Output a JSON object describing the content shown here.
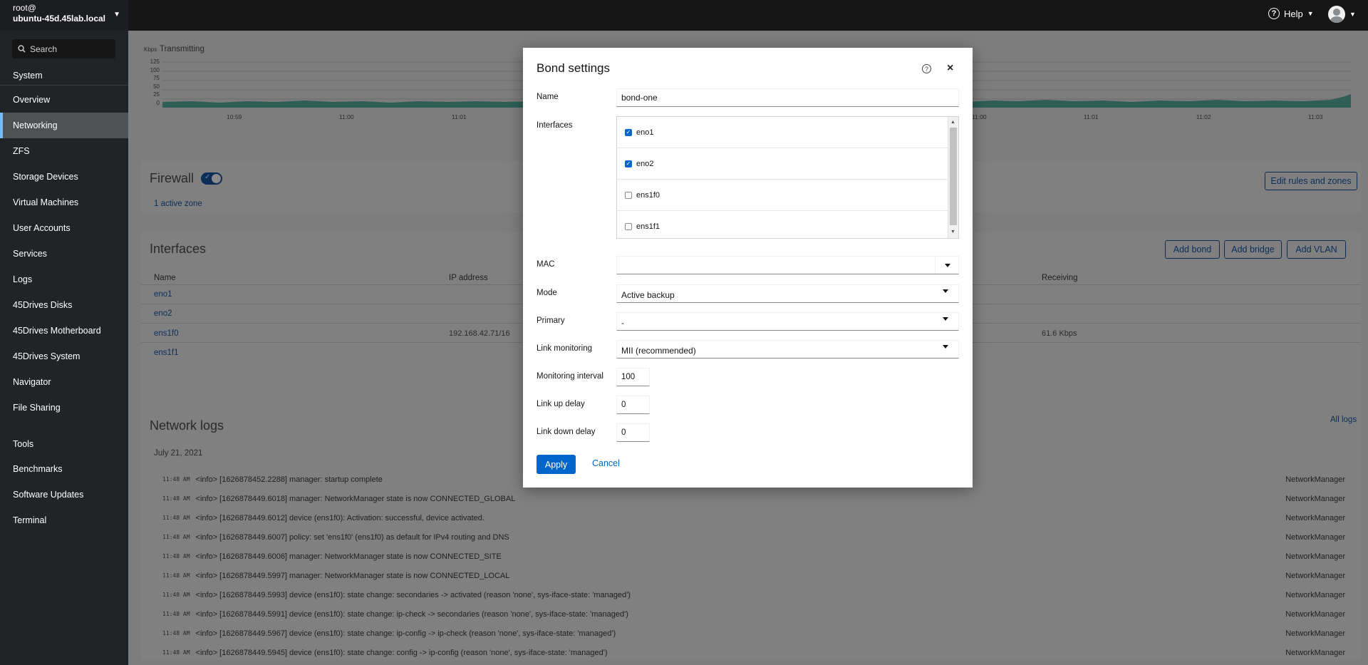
{
  "host": {
    "user": "root@",
    "hostname": "ubuntu-45d.45lab.local"
  },
  "topbar": {
    "help_label": "Help"
  },
  "sidebar": {
    "search_placeholder": "Search",
    "section_system": "System",
    "items": [
      "Overview",
      "Networking",
      "ZFS",
      "Storage Devices",
      "Virtual Machines",
      "User Accounts",
      "Services",
      "Logs",
      "45Drives Disks",
      "45Drives Motherboard",
      "45Drives System",
      "Navigator",
      "File Sharing"
    ],
    "section_tools": "Tools",
    "tools": [
      "Benchmarks",
      "Software Updates",
      "Terminal"
    ],
    "active": "Networking"
  },
  "graph": {
    "unit": "Kbps",
    "title": "Transmitting",
    "y_ticks": [
      "125",
      "100",
      "75",
      "50",
      "25",
      "0"
    ],
    "x_ticks_left": [
      "10:59",
      "11:00",
      "11:01"
    ],
    "x_ticks_right": [
      "11:00",
      "11:01",
      "11:02",
      "11:03"
    ]
  },
  "firewall": {
    "title": "Firewall",
    "enabled": true,
    "zones_link": "1 active zone",
    "edit_button": "Edit rules and zones"
  },
  "interfaces": {
    "title": "Interfaces",
    "buttons": [
      "Add bond",
      "Add bridge",
      "Add VLAN"
    ],
    "columns": {
      "name": "Name",
      "ip": "IP address",
      "receiving": "Receiving"
    },
    "rows": [
      {
        "name": "eno1",
        "ip": "",
        "receiving": ""
      },
      {
        "name": "eno2",
        "ip": "",
        "receiving": ""
      },
      {
        "name": "ens1f0",
        "ip": "192.168.42.71/16",
        "receiving": "61.6 Kbps"
      },
      {
        "name": "ens1f1",
        "ip": "",
        "receiving": ""
      }
    ]
  },
  "network_logs": {
    "title": "Network logs",
    "all_logs_link": "All logs",
    "date": "July 21, 2021",
    "entries": [
      {
        "time": "11:48 AM",
        "message": "<info> [1626878452.2288] manager: startup complete",
        "source": "NetworkManager"
      },
      {
        "time": "11:48 AM",
        "message": "<info> [1626878449.6018] manager: NetworkManager state is now CONNECTED_GLOBAL",
        "source": "NetworkManager"
      },
      {
        "time": "11:48 AM",
        "message": "<info> [1626878449.6012] device (ens1f0): Activation: successful, device activated.",
        "source": "NetworkManager"
      },
      {
        "time": "11:48 AM",
        "message": "<info> [1626878449.6007] policy: set 'ens1f0' (ens1f0) as default for IPv4 routing and DNS",
        "source": "NetworkManager"
      },
      {
        "time": "11:48 AM",
        "message": "<info> [1626878449.6006] manager: NetworkManager state is now CONNECTED_SITE",
        "source": "NetworkManager"
      },
      {
        "time": "11:48 AM",
        "message": "<info> [1626878449.5997] manager: NetworkManager state is now CONNECTED_LOCAL",
        "source": "NetworkManager"
      },
      {
        "time": "11:48 AM",
        "message": "<info> [1626878449.5993] device (ens1f0): state change: secondaries -> activated (reason 'none', sys-iface-state: 'managed')",
        "source": "NetworkManager"
      },
      {
        "time": "11:48 AM",
        "message": "<info> [1626878449.5991] device (ens1f0): state change: ip-check -> secondaries (reason 'none', sys-iface-state: 'managed')",
        "source": "NetworkManager"
      },
      {
        "time": "11:48 AM",
        "message": "<info> [1626878449.5967] device (ens1f0): state change: ip-config -> ip-check (reason 'none', sys-iface-state: 'managed')",
        "source": "NetworkManager"
      },
      {
        "time": "11:48 AM",
        "message": "<info> [1626878449.5945] device (ens1f0): state change: config -> ip-config (reason 'none', sys-iface-state: 'managed')",
        "source": "NetworkManager"
      }
    ]
  },
  "modal": {
    "title": "Bond settings",
    "labels": {
      "name": "Name",
      "interfaces": "Interfaces",
      "mac": "MAC",
      "mode": "Mode",
      "primary": "Primary",
      "link_monitoring": "Link monitoring",
      "monitoring_interval": "Monitoring interval",
      "link_up_delay": "Link up delay",
      "link_down_delay": "Link down delay"
    },
    "name_value": "bond-one",
    "interfaces": [
      {
        "name": "eno1",
        "checked": true
      },
      {
        "name": "eno2",
        "checked": true
      },
      {
        "name": "ens1f0",
        "checked": false
      },
      {
        "name": "ens1f1",
        "checked": false
      }
    ],
    "mac_value": "",
    "mode_value": "Active backup",
    "primary_value": "-",
    "link_monitoring_value": "MII (recommended)",
    "monitoring_interval_value": "100",
    "link_up_delay_value": "0",
    "link_down_delay_value": "0",
    "apply_label": "Apply",
    "cancel_label": "Cancel",
    "accent_color": "#0066cc"
  }
}
